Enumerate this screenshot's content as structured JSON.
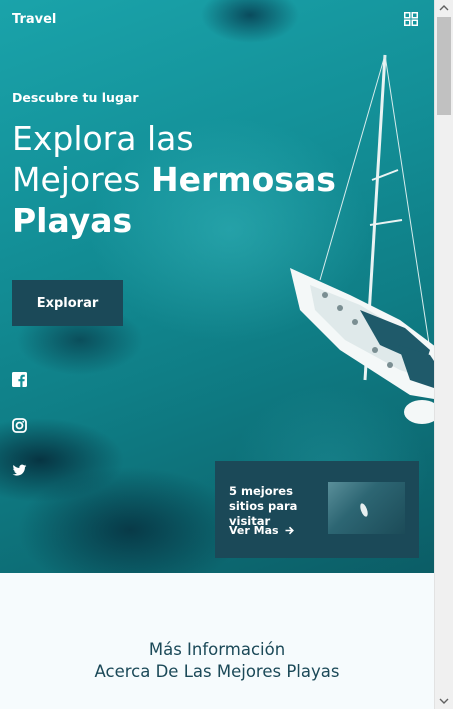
{
  "header": {
    "title": "Travel",
    "menu_icon": "grid-icon"
  },
  "hero": {
    "eyebrow": "Descubre tu lugar",
    "headline_line1": "Explora las",
    "headline_line2_regular": "Mejores ",
    "headline_line2_bold": "Hermosas",
    "headline_line3_bold": "Playas",
    "cta_label": "Explorar"
  },
  "social": [
    {
      "name": "facebook-icon"
    },
    {
      "name": "instagram-icon"
    },
    {
      "name": "twitter-icon"
    }
  ],
  "card": {
    "title": "5 mejores sitios para visitar",
    "link_label": "Ver Mas",
    "link_icon": "arrow-right-icon"
  },
  "more_info": {
    "line1": "Más Información",
    "line2": "Acerca De Las Mejores Playas"
  },
  "colors": {
    "accent": "#1b4958",
    "sea": "#138f97",
    "page_bg": "#f6fbfd"
  }
}
